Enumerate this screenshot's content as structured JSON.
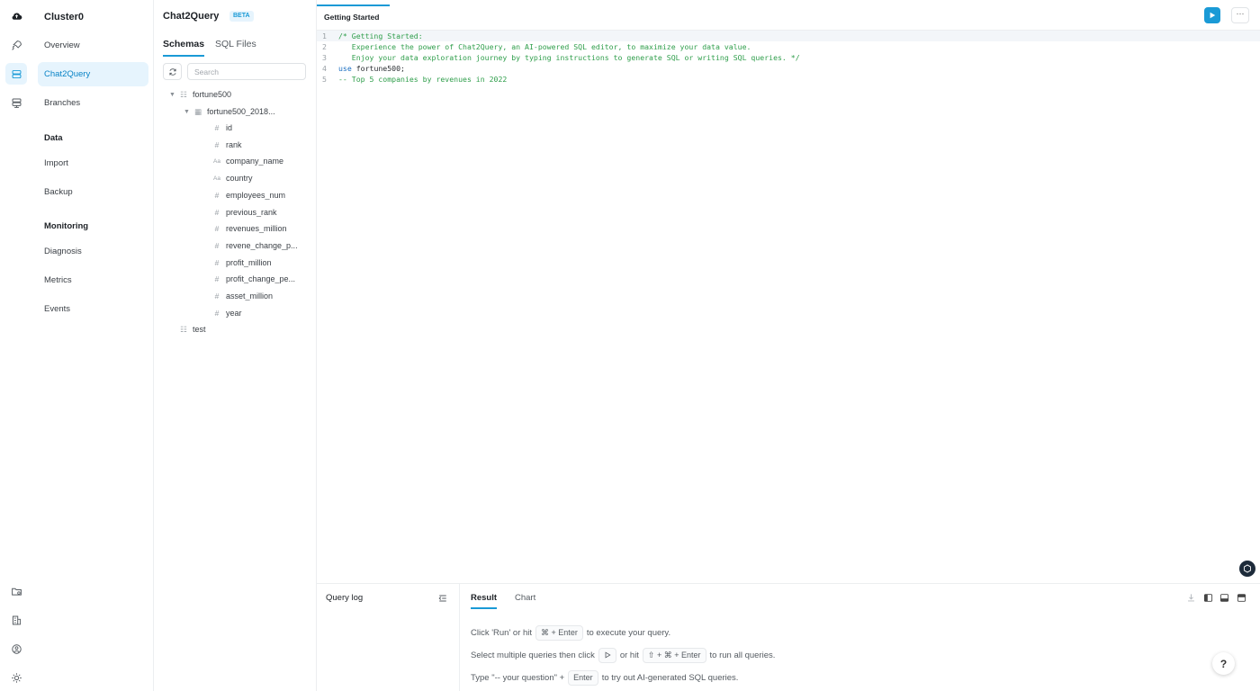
{
  "nav": {
    "cluster": "Cluster0",
    "items": {
      "overview": "Overview",
      "chat2query": "Chat2Query",
      "branches": "Branches",
      "import": "Import",
      "backup": "Backup",
      "diagnosis": "Diagnosis",
      "metrics": "Metrics",
      "events": "Events"
    },
    "sections": {
      "data": "Data",
      "monitoring": "Monitoring"
    }
  },
  "schema_panel": {
    "title": "Chat2Query",
    "badge": "BETA",
    "tabs": {
      "schemas": "Schemas",
      "sql_files": "SQL Files"
    },
    "search_placeholder": "Search",
    "tree": {
      "db1": "fortune500",
      "table1": "fortune500_2018...",
      "columns": [
        "id",
        "rank",
        "company_name",
        "country",
        "employees_num",
        "previous_rank",
        "revenues_million",
        "revene_change_p...",
        "profit_million",
        "profit_change_pe...",
        "asset_million",
        "year"
      ],
      "db2": "test"
    }
  },
  "editor": {
    "tab": "Getting Started",
    "more": "···",
    "lines": {
      "n1": "1",
      "n2": "2",
      "n3": "3",
      "n4": "4",
      "n5": "5",
      "l1": "/* Getting Started:",
      "l2": "   Experience the power of Chat2Query, an AI-powered SQL editor, to maximize your data value.",
      "l3": "   Enjoy your data exploration journey by typing instructions to generate SQL or writing SQL queries. */",
      "l4_kw": "use",
      "l4_id": " fortune500;",
      "l5": "-- Top 5 companies by revenues in 2022"
    }
  },
  "bottom": {
    "query_log": "Query log",
    "tabs": {
      "result": "Result",
      "chart": "Chart"
    },
    "hint1": {
      "a": "Click 'Run' or hit",
      "key": "⌘ + Enter",
      "b": "to execute your query."
    },
    "hint2": {
      "a": "Select multiple queries then click",
      "b": "or hit",
      "key": "⇧ + ⌘ + Enter",
      "c": "to run all queries."
    },
    "hint3": {
      "a": "Type \"-- your question\" +",
      "key": "Enter",
      "b": "to try out AI-generated SQL queries."
    }
  },
  "help": "?",
  "colors": {
    "accent": "#1a9ad6",
    "active_bg": "#e6f4fd",
    "comment": "#2f9e4b",
    "keyword": "#1b6fc2"
  }
}
